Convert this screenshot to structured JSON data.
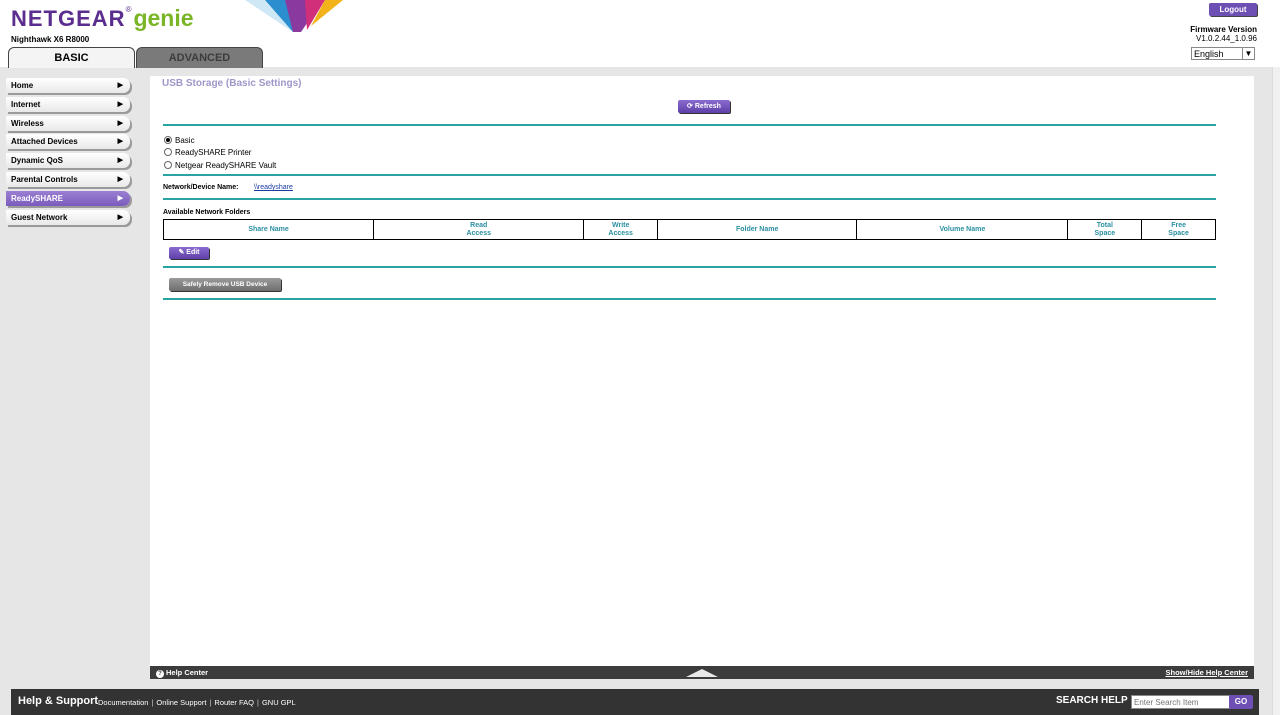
{
  "header": {
    "brand_netgear": "NETGEAR",
    "brand_reg": "®",
    "brand_genie": "genie",
    "model": "Nighthawk X6 R8000",
    "logout_label": "Logout",
    "firmware_label": "Firmware Version",
    "firmware_value": "V1.0.2.44_1.0.96",
    "language": "English",
    "accent_color": "#5b2d8e",
    "genie_color": "#7ab526"
  },
  "tabs": [
    {
      "label": "BASIC",
      "active": true
    },
    {
      "label": "ADVANCED",
      "active": false
    }
  ],
  "sidebar": {
    "items": [
      {
        "label": "Home"
      },
      {
        "label": "Internet"
      },
      {
        "label": "Wireless"
      },
      {
        "label": "Attached Devices"
      },
      {
        "label": "Dynamic QoS"
      },
      {
        "label": "Parental Controls"
      },
      {
        "label": "ReadySHARE",
        "active": true
      },
      {
        "label": "Guest Network"
      }
    ],
    "arrow_icon": "triangle-right-icon"
  },
  "main": {
    "title": "USB Storage (Basic Settings)",
    "refresh_label": "Refresh",
    "refresh_icon": "refresh-icon",
    "modes": [
      {
        "label": "Basic",
        "checked": true
      },
      {
        "label": "ReadySHARE Printer",
        "checked": false
      },
      {
        "label": "Netgear ReadySHARE Vault",
        "checked": false
      }
    ],
    "network_name_label": "Network/Device Name:",
    "network_name_value": "\\\\readyshare",
    "folders_title": "Available Network Folders",
    "table_columns": [
      {
        "line1": "Share Name",
        "line2": ""
      },
      {
        "line1": "Read",
        "line2": "Access"
      },
      {
        "line1": "Write",
        "line2": "Access"
      },
      {
        "line1": "Folder Name",
        "line2": ""
      },
      {
        "line1": "Volume Name",
        "line2": ""
      },
      {
        "line1": "Total",
        "line2": "Space"
      },
      {
        "line1": "Free",
        "line2": "Space"
      }
    ],
    "edit_label": "Edit",
    "edit_icon": "pencil-icon",
    "safely_remove_label": "Safely Remove USB Device",
    "rule_color": "#2aa3a3"
  },
  "helpbar": {
    "help_center_label": "Help Center",
    "help_icon": "question-icon",
    "show_hide_label": "Show/Hide Help Center"
  },
  "footer": {
    "title": "Help & Support",
    "links": [
      "Documentation",
      "Online Support",
      "Router FAQ",
      "GNU GPL"
    ],
    "search_label": "SEARCH HELP",
    "search_placeholder": "Enter Search Item",
    "go_label": "GO"
  }
}
